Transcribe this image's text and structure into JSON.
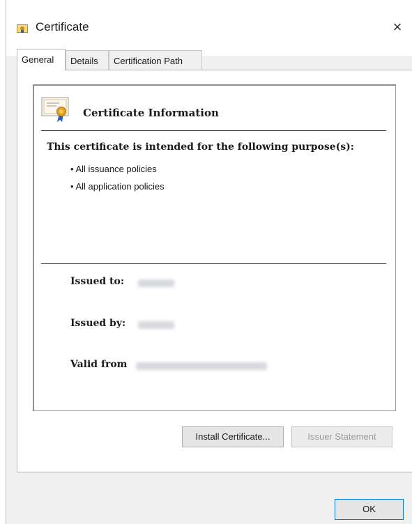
{
  "window": {
    "title": "Certificate",
    "close_glyph": "×"
  },
  "tabs": [
    {
      "label": "General"
    },
    {
      "label": "Details"
    },
    {
      "label": "Certification Path"
    }
  ],
  "info": {
    "title": "Certificate Information",
    "purpose_heading": "This certificate is intended for the following purpose(s):",
    "purposes": [
      "• All issuance policies",
      "• All application policies"
    ]
  },
  "fields": {
    "issued_to_label": "Issued to:",
    "issued_by_label": "Issued by:",
    "valid_from_label": "Valid from"
  },
  "buttons": {
    "install": "Install Certificate...",
    "issuer_statement": "Issuer Statement",
    "ok": "OK"
  },
  "icons": {
    "title": "certificate-icon",
    "info": "certificate-icon",
    "close": "close-icon"
  }
}
